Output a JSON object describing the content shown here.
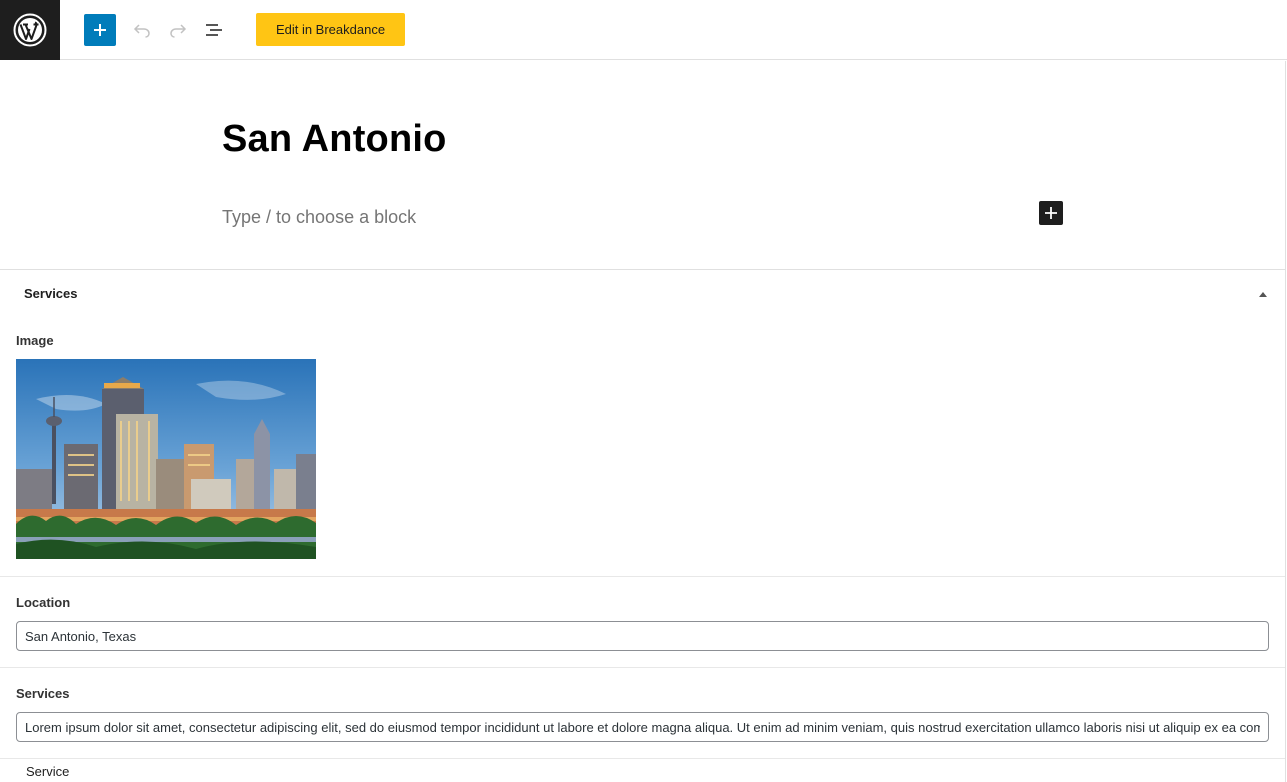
{
  "toolbar": {
    "logo_icon": "wordpress-logo",
    "add_icon": "plus-icon",
    "undo_icon": "undo-icon",
    "redo_icon": "redo-icon",
    "list_view_icon": "list-view-icon",
    "breakdance_label": "Edit in Breakdance",
    "accent_color": "#007cba",
    "breakdance_color": "#ffc514"
  },
  "editor": {
    "title": "San Antonio",
    "block_placeholder": "Type / to choose a block"
  },
  "metabox": {
    "title": "Services",
    "toggle_icon": "triangle-up-icon",
    "fields": {
      "image": {
        "label": "Image"
      },
      "location": {
        "label": "Location",
        "value": "San Antonio, Texas"
      },
      "services": {
        "label": "Services",
        "value": "Lorem ipsum dolor sit amet, consectetur adipiscing elit, sed do eiusmod tempor incididunt ut labore et dolore magna aliqua. Ut enim ad minim veniam, quis nostrud exercitation ullamco laboris nisi ut aliquip ex ea commodo consequat."
      },
      "service": {
        "label": "Service"
      }
    }
  }
}
